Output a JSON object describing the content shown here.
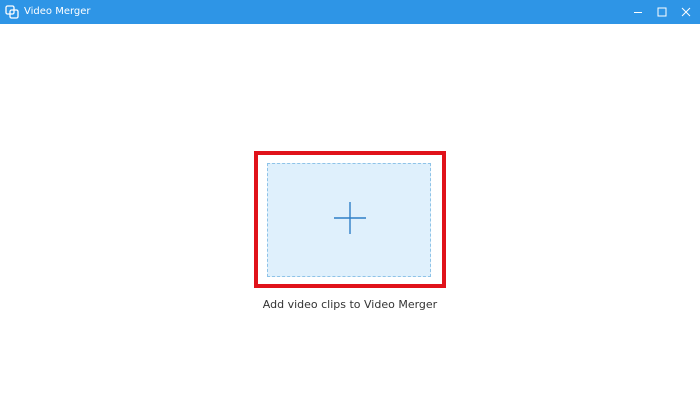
{
  "window": {
    "title": "Video Merger",
    "app_icon": "video-merger-app-icon",
    "controls": {
      "minimize": "minimize-icon",
      "maximize": "maximize-icon",
      "close": "close-icon"
    }
  },
  "main": {
    "add_label": "Add video clips to Video Merger",
    "add_icon": "plus-icon"
  },
  "colors": {
    "titlebar": "#2e95e6",
    "highlight": "#e0121a",
    "dropzone_fill": "#dff0fc",
    "dropzone_border": "#8ec3e8",
    "plus": "#2e7fc7"
  }
}
